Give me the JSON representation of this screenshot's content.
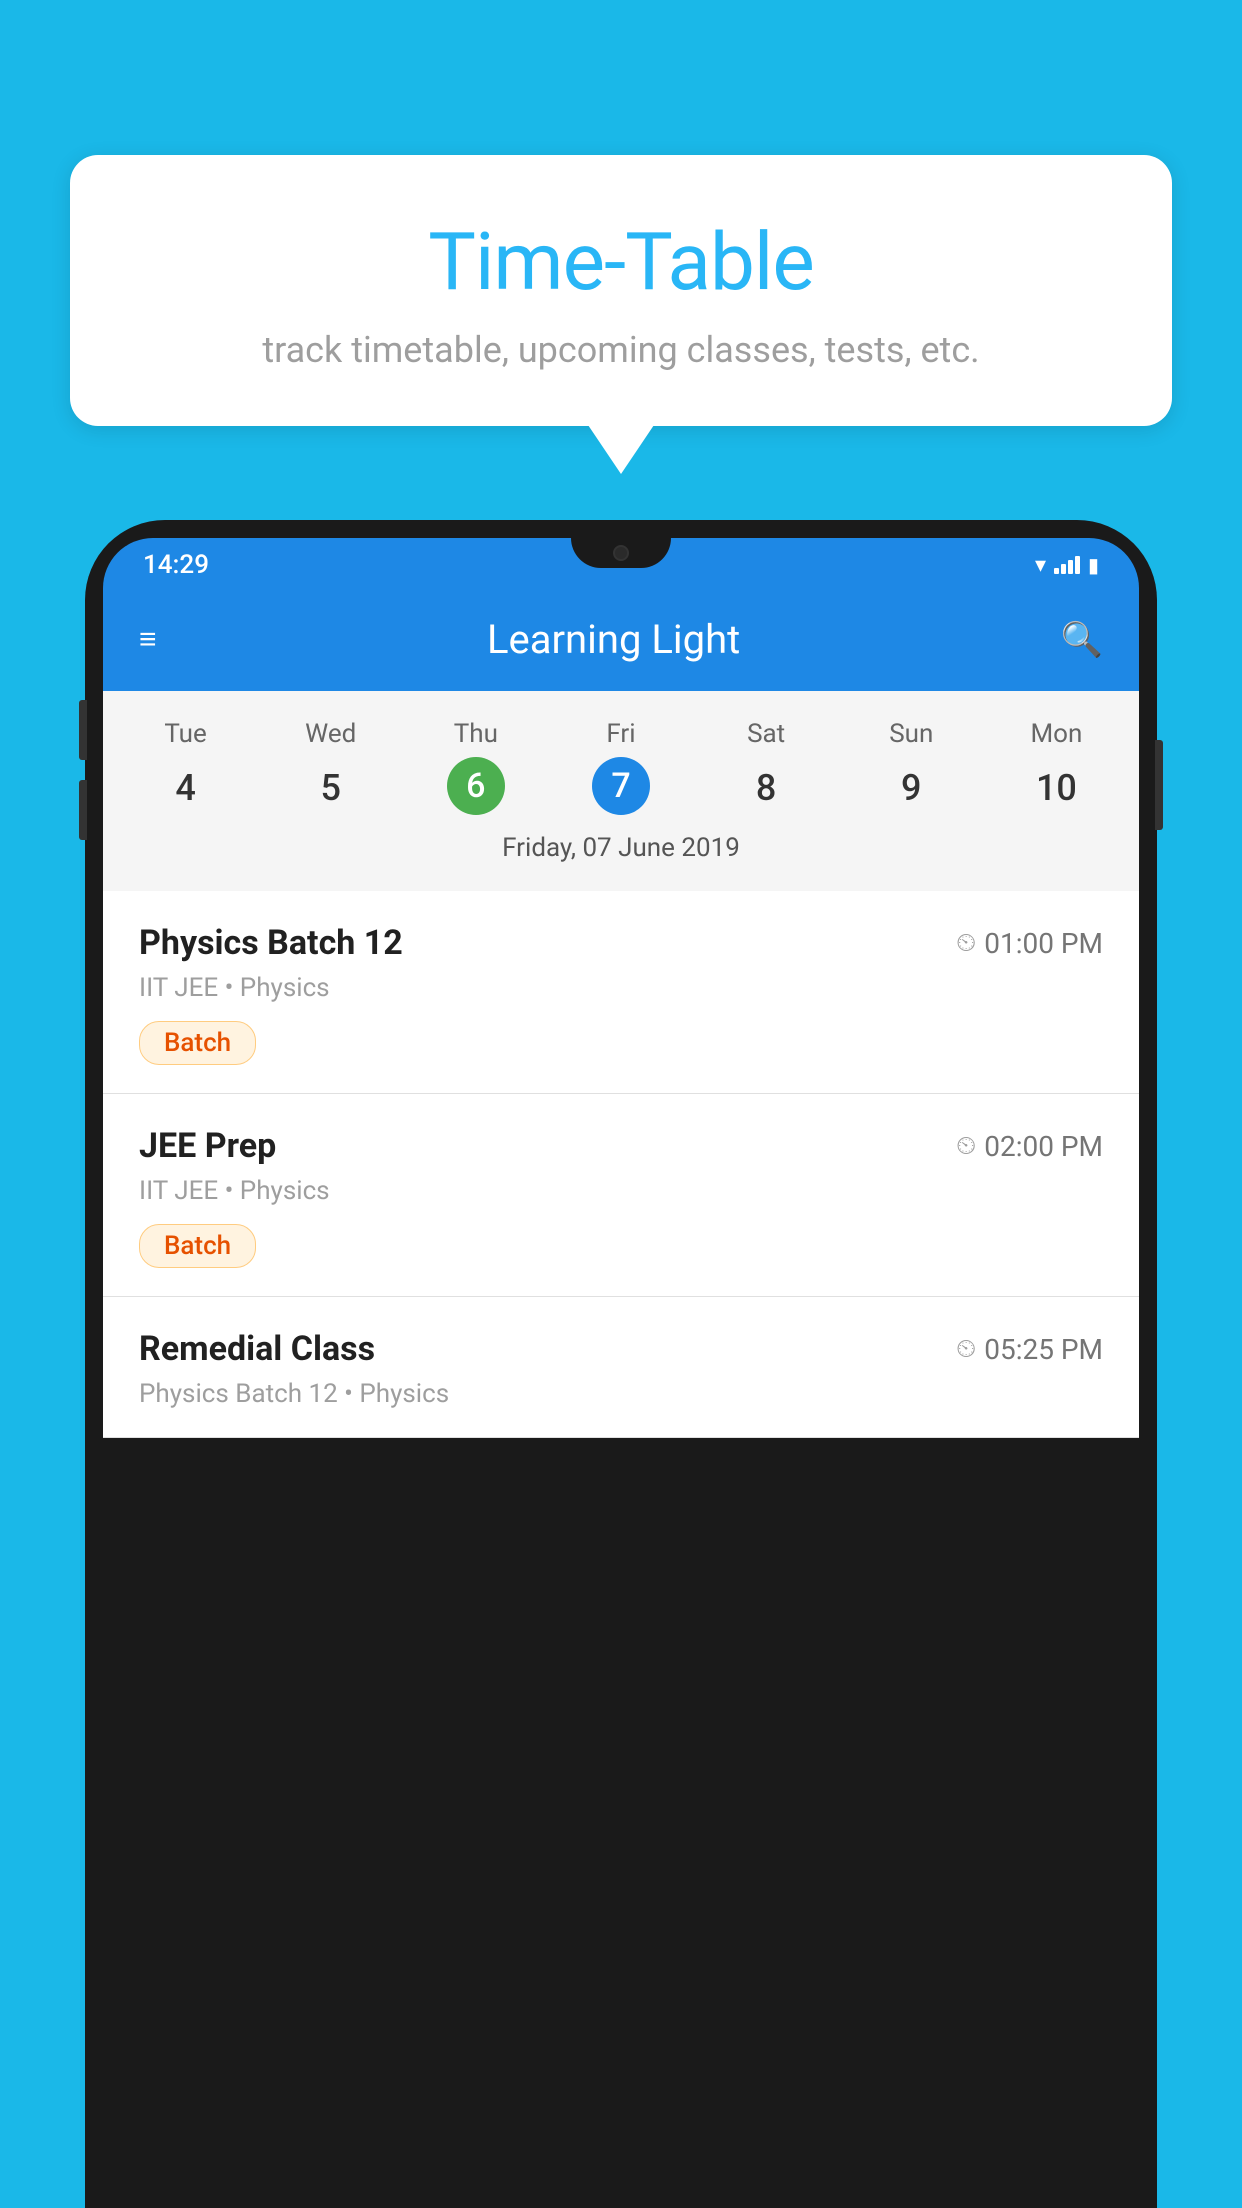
{
  "page": {
    "background_color": "#1ab8e8"
  },
  "speech_bubble": {
    "title": "Time-Table",
    "subtitle": "track timetable, upcoming classes, tests, etc."
  },
  "phone": {
    "status_bar": {
      "time": "14:29"
    },
    "app_bar": {
      "title": "Learning Light"
    },
    "calendar": {
      "days": [
        {
          "short": "Tue",
          "num": "4"
        },
        {
          "short": "Wed",
          "num": "5"
        },
        {
          "short": "Thu",
          "num": "6",
          "state": "today"
        },
        {
          "short": "Fri",
          "num": "7",
          "state": "selected"
        },
        {
          "short": "Sat",
          "num": "8"
        },
        {
          "short": "Sun",
          "num": "9"
        },
        {
          "short": "Mon",
          "num": "10"
        }
      ],
      "selected_date_label": "Friday, 07 June 2019"
    },
    "schedule": [
      {
        "title": "Physics Batch 12",
        "time": "01:00 PM",
        "subtitle": "IIT JEE • Physics",
        "badge": "Batch"
      },
      {
        "title": "JEE Prep",
        "time": "02:00 PM",
        "subtitle": "IIT JEE • Physics",
        "badge": "Batch"
      },
      {
        "title": "Remedial Class",
        "time": "05:25 PM",
        "subtitle": "Physics Batch 12 • Physics",
        "badge": null
      }
    ]
  }
}
